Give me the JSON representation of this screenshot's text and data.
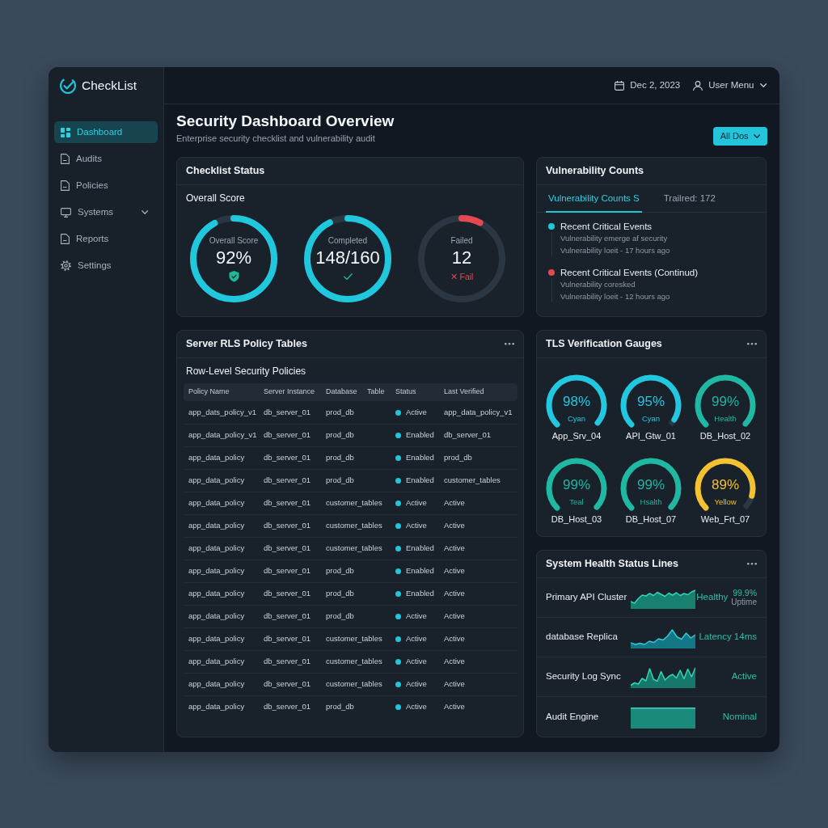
{
  "sidebar": {
    "logo": "CheckList",
    "items": [
      {
        "label": "Dashboard",
        "selected": true,
        "kind": "link"
      },
      {
        "label": "Audits",
        "selected": false,
        "kind": "link"
      },
      {
        "label": "Policies",
        "selected": false,
        "kind": "link"
      },
      {
        "label": "Systems",
        "selected": false,
        "kind": "group"
      },
      {
        "label": "Reports",
        "selected": false,
        "kind": "link"
      },
      {
        "label": "Settings",
        "selected": false,
        "kind": "link"
      }
    ]
  },
  "header": {
    "date": "Dec 2, 2023",
    "user_menu": "User Menu"
  },
  "page": {
    "title": "Security Dashboard Overview",
    "subtitle": "Enterprise security checklist and vulnerability audit",
    "filter_button": "All Dos"
  },
  "checklist_status": {
    "title": "Checklist Status",
    "subtitle": "Overall Score",
    "rings": [
      {
        "label": "Overall Score",
        "value": "92%",
        "level": 0.92,
        "kind": "shield"
      },
      {
        "label": "Completed",
        "value": "148/160",
        "level": 0.925,
        "kind": "check"
      },
      {
        "label": "Failed",
        "value": "12",
        "level": 0.075,
        "kind": "fail",
        "note": "✕ Fail"
      }
    ]
  },
  "vulnerability_counts": {
    "title": "Vulnerability Counts",
    "tabs": [
      {
        "label": "Vulnerability Counts S",
        "selected": true
      },
      {
        "label": "Trailred: 172",
        "selected": false
      }
    ],
    "events": [
      {
        "title": "Recent Critical Events",
        "details": [
          "Vulnerability emerge af security",
          "Vulnerability loeit - 17 hours ago"
        ],
        "color": "#1fc8dd"
      },
      {
        "title": "Recent Critical Events (Continud)",
        "details": [
          "Vulnerability coresked",
          "Vulnerability loeit - 12 hours ago"
        ],
        "color": "#e5484d"
      }
    ]
  },
  "rls_policies": {
    "title": "Server RLS Policy Tables",
    "subtitle": "Row-Level Security Policies",
    "columns": [
      "Policy Name",
      "Server Instance",
      "Database",
      "Table",
      "Status",
      "Last Verified"
    ],
    "rows": [
      {
        "policy_name": "app_dats_policy_v1",
        "server_instance": "db_server_01",
        "database": "prod_db",
        "status": "Active",
        "last_verified": "app_data_policy_v1"
      },
      {
        "policy_name": "app_data_policy_v1",
        "server_instance": "db_server_01",
        "database": "prod_db",
        "status": "Enabled",
        "last_verified": "db_server_01"
      },
      {
        "policy_name": "app_data_policy",
        "server_instance": "db_server_01",
        "database": "prod_db",
        "status": "Enabled",
        "last_verified": "prod_db"
      },
      {
        "policy_name": "app_data_policy",
        "server_instance": "db_server_01",
        "database": "prod_db",
        "status": "Enabled",
        "last_verified": "customer_tables"
      },
      {
        "policy_name": "app_data_policy",
        "server_instance": "db_server_01",
        "database": "customer_tables",
        "status": "Active",
        "last_verified": "Active"
      },
      {
        "policy_name": "app_data_policy",
        "server_instance": "db_server_01",
        "database": "customer_tables",
        "status": "Active",
        "last_verified": "Active"
      },
      {
        "policy_name": "app_data_policy",
        "server_instance": "db_server_01",
        "database": "customer_tables",
        "status": "Enabled",
        "last_verified": "Active"
      },
      {
        "policy_name": "app_data_policy",
        "server_instance": "db_server_01",
        "database": "prod_db",
        "status": "Enabled",
        "last_verified": "Active"
      },
      {
        "policy_name": "app_data_policy",
        "server_instance": "db_server_01",
        "database": "prod_db",
        "status": "Enabled",
        "last_verified": "Active"
      },
      {
        "policy_name": "app_data_policy",
        "server_instance": "db_server_01",
        "database": "prod_db",
        "status": "Active",
        "last_verified": "Active"
      },
      {
        "policy_name": "app_data_policy",
        "server_instance": "db_server_01",
        "database": "customer_tables",
        "status": "Active",
        "last_verified": "Active"
      },
      {
        "policy_name": "app_data_policy",
        "server_instance": "db_server_01",
        "database": "customer_tables",
        "status": "Active",
        "last_verified": "Active"
      },
      {
        "policy_name": "app_data_policy",
        "server_instance": "db_server_01",
        "database": "customer_tables",
        "status": "Active",
        "last_verified": "Active"
      },
      {
        "policy_name": "app_data_policy",
        "server_instance": "db_server_01",
        "database": "prod_db",
        "status": "Active",
        "last_verified": "Active"
      }
    ]
  },
  "tls_gauges": {
    "title": "TLS Verification Gauges",
    "gauges": [
      {
        "value": "98%",
        "caption": "Cyan",
        "name": "App_Srv_04",
        "level": 0.98,
        "color": "#22c8e0"
      },
      {
        "value": "95%",
        "caption": "Cyan",
        "name": "API_Gtw_01",
        "level": 0.95,
        "color": "#22c8e0"
      },
      {
        "value": "99%",
        "caption": "Health",
        "name": "DB_Host_02",
        "level": 0.99,
        "color": "#1fb8a3"
      },
      {
        "value": "99%",
        "caption": "Teal",
        "name": "DB_Host_03",
        "level": 0.99,
        "color": "#1fb8a3"
      },
      {
        "value": "99%",
        "caption": "Hsalth",
        "name": "DB_Host_07",
        "level": 0.99,
        "color": "#1fb8a3"
      },
      {
        "value": "89%",
        "caption": "Yellow",
        "name": "Web_Frt_07",
        "level": 0.89,
        "color": "#f2c230"
      }
    ]
  },
  "health_lines": {
    "title": "System Health Status Lines",
    "rows": [
      {
        "label": "Primary API Cluster",
        "status": "Healthy",
        "metric": "99.9%",
        "metric_label": "Uptime"
      },
      {
        "label": "database Replica",
        "status": "Latency 14ms"
      },
      {
        "label": "Security Log Sync",
        "status": "Active"
      },
      {
        "label": "Audit Engine",
        "status": "Nominal"
      }
    ]
  }
}
